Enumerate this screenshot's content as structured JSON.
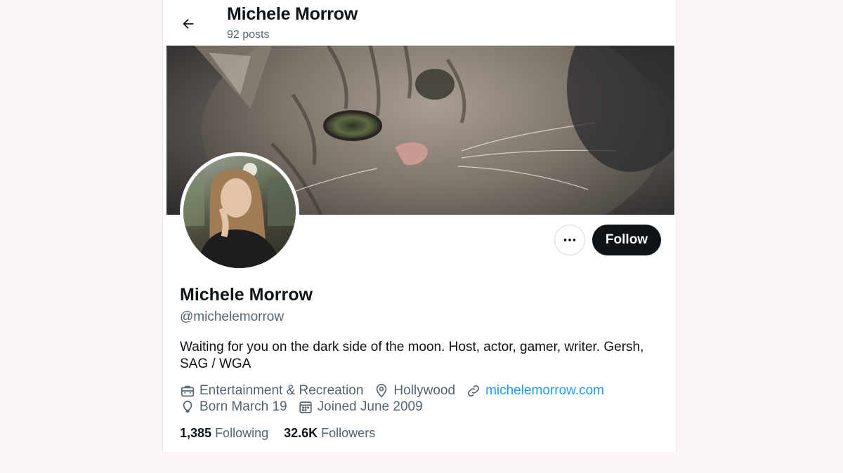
{
  "header": {
    "title": "Michele Morrow",
    "posts_count": "92 posts",
    "back_icon": "arrow-left-icon"
  },
  "profile": {
    "display_name": "Michele Morrow",
    "handle": "@michelemorrow",
    "bio": "Waiting for you on the dark side of the moon. Host, actor, gamer, writer. Gersh, SAG / WGA",
    "category": "Entertainment & Recreation",
    "location": "Hollywood",
    "website": "michelemorrow.com",
    "birthday": "Born March 19",
    "joined": "Joined June 2009"
  },
  "actions": {
    "more_icon": "more-horizontal-icon",
    "follow_label": "Follow"
  },
  "stats": {
    "following_count": "1,385",
    "following_label": "Following",
    "followers_count": "32.6K",
    "followers_label": "Followers"
  },
  "colors": {
    "text_primary": "#0f1419",
    "text_secondary": "#536471",
    "link": "#1d9bf0",
    "follow_bg": "#0f1419"
  }
}
